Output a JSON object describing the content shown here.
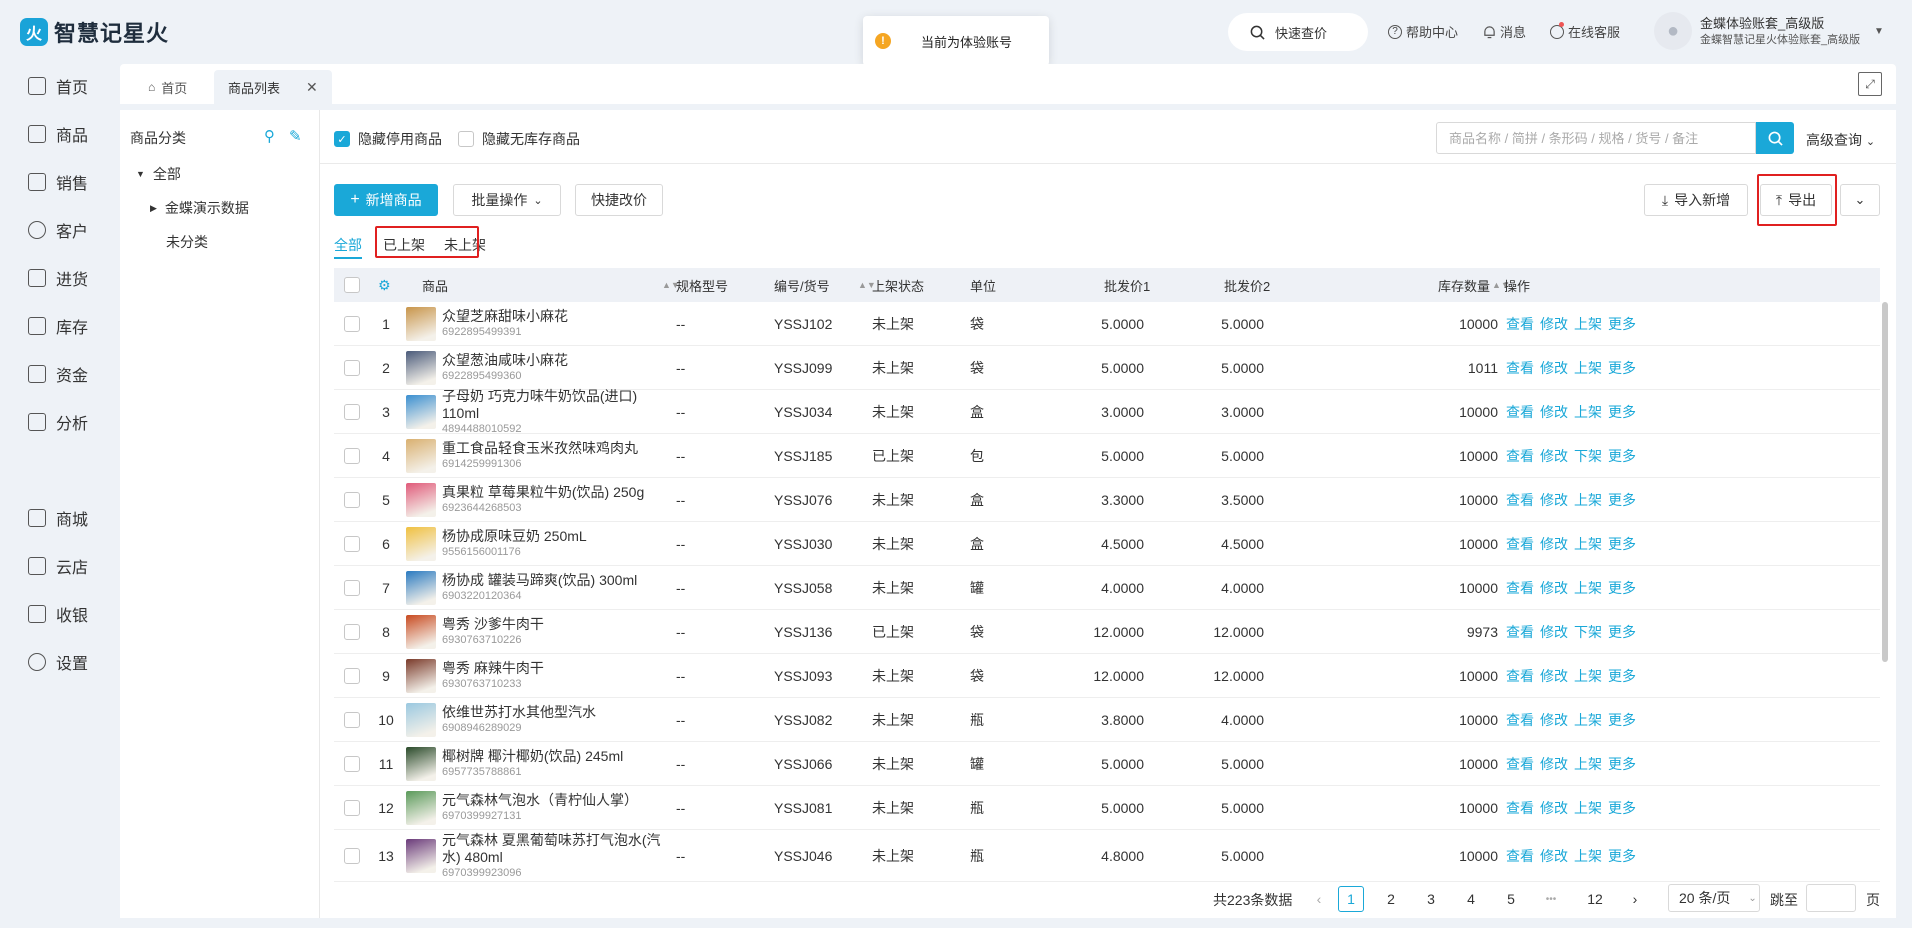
{
  "app": {
    "logo_char": "火",
    "title": "智慧记星火"
  },
  "toast": {
    "icon": "!",
    "text": "当前为体验账号"
  },
  "header": {
    "quick_price": "快速查价",
    "help": "帮助中心",
    "messages": "消息",
    "service": "在线客服",
    "user_name": "金蝶体验账套_高级版",
    "user_sub": "金蝶智慧记星火体验账套_高级版"
  },
  "sidebar": {
    "items": [
      {
        "label": "首页",
        "icon": "home-icon"
      },
      {
        "label": "商品",
        "icon": "product-icon"
      },
      {
        "label": "销售",
        "icon": "sales-icon"
      },
      {
        "label": "客户",
        "icon": "customer-icon"
      },
      {
        "label": "进货",
        "icon": "purchase-icon"
      },
      {
        "label": "库存",
        "icon": "inventory-icon"
      },
      {
        "label": "资金",
        "icon": "fund-icon"
      },
      {
        "label": "分析",
        "icon": "analysis-icon"
      },
      {
        "label": "商城",
        "icon": "mall-icon"
      },
      {
        "label": "云店",
        "icon": "cloud-store-icon"
      },
      {
        "label": "收银",
        "icon": "cashier-icon"
      },
      {
        "label": "设置",
        "icon": "settings-icon"
      }
    ]
  },
  "tabs": [
    {
      "label": "首页"
    },
    {
      "label": "商品列表"
    }
  ],
  "category": {
    "title": "商品分类",
    "root": "全部",
    "child": "金蝶演示数据",
    "uncategorized": "未分类"
  },
  "filters": {
    "hide_disabled": "隐藏停用商品",
    "hide_no_stock": "隐藏无库存商品",
    "search_placeholder": "商品名称 / 简拼 / 条形码 / 规格 / 货号 / 备注",
    "advanced": "高级查询"
  },
  "toolbar": {
    "add": "新增商品",
    "batch": "批量操作",
    "quick_price_edit": "快捷改价",
    "import": "导入新增",
    "export": "导出"
  },
  "status_tabs": [
    "全部",
    "已上架",
    "未上架"
  ],
  "table": {
    "headers": {
      "product": "商品",
      "spec": "规格型号",
      "code": "编号/货号",
      "status": "上架状态",
      "unit": "单位",
      "price1": "批发价1",
      "price2": "批发价2",
      "stock": "库存数量",
      "ops": "操作"
    },
    "ops_view": "查看",
    "ops_edit": "修改",
    "ops_more": "更多",
    "rows": [
      {
        "no": "1",
        "name": "众望芝麻甜味小麻花",
        "barcode": "6922895499391",
        "spec": "--",
        "code": "YSSJ102",
        "status": "未上架",
        "unit": "袋",
        "p1": "5.0000",
        "p2": "5.0000",
        "stock": "10000",
        "toggle": "上架",
        "color": "#c8954a"
      },
      {
        "no": "2",
        "name": "众望葱油咸味小麻花",
        "barcode": "6922895499360",
        "spec": "--",
        "code": "YSSJ099",
        "status": "未上架",
        "unit": "袋",
        "p1": "5.0000",
        "p2": "5.0000",
        "stock": "1011",
        "toggle": "上架",
        "color": "#4a5a7a"
      },
      {
        "no": "3",
        "name": "子母奶 巧克力味牛奶饮品(进口) 110ml",
        "barcode": "4894488010592",
        "spec": "--",
        "code": "YSSJ034",
        "status": "未上架",
        "unit": "盒",
        "p1": "3.0000",
        "p2": "3.0000",
        "stock": "10000",
        "toggle": "上架",
        "color": "#3a8fd0"
      },
      {
        "no": "4",
        "name": "重工食品轻食玉米孜然味鸡肉丸",
        "barcode": "6914259991306",
        "spec": "--",
        "code": "YSSJ185",
        "status": "已上架",
        "unit": "包",
        "p1": "5.0000",
        "p2": "5.0000",
        "stock": "10000",
        "toggle": "下架",
        "color": "#d9b070"
      },
      {
        "no": "5",
        "name": "真果粒 草莓果粒牛奶(饮品) 250g",
        "barcode": "6923644268503",
        "spec": "--",
        "code": "YSSJ076",
        "status": "未上架",
        "unit": "盒",
        "p1": "3.3000",
        "p2": "3.5000",
        "stock": "10000",
        "toggle": "上架",
        "color": "#e05a7a"
      },
      {
        "no": "6",
        "name": "杨协成原味豆奶 250mL",
        "barcode": "9556156001176",
        "spec": "--",
        "code": "YSSJ030",
        "status": "未上架",
        "unit": "盒",
        "p1": "4.5000",
        "p2": "4.5000",
        "stock": "10000",
        "toggle": "上架",
        "color": "#f0c040"
      },
      {
        "no": "7",
        "name": "杨协成 罐装马蹄爽(饮品) 300ml",
        "barcode": "6903220120364",
        "spec": "--",
        "code": "YSSJ058",
        "status": "未上架",
        "unit": "罐",
        "p1": "4.0000",
        "p2": "4.0000",
        "stock": "10000",
        "toggle": "上架",
        "color": "#2a7ac0"
      },
      {
        "no": "8",
        "name": "粤秀 沙爹牛肉干",
        "barcode": "6930763710226",
        "spec": "--",
        "code": "YSSJ136",
        "status": "已上架",
        "unit": "袋",
        "p1": "12.0000",
        "p2": "12.0000",
        "stock": "9973",
        "toggle": "下架",
        "color": "#c84a20"
      },
      {
        "no": "9",
        "name": "粤秀 麻辣牛肉干",
        "barcode": "6930763710233",
        "spec": "--",
        "code": "YSSJ093",
        "status": "未上架",
        "unit": "袋",
        "p1": "12.0000",
        "p2": "12.0000",
        "stock": "10000",
        "toggle": "上架",
        "color": "#7a3a2a"
      },
      {
        "no": "10",
        "name": "依维世苏打水其他型汽水",
        "barcode": "6908946289029",
        "spec": "--",
        "code": "YSSJ082",
        "status": "未上架",
        "unit": "瓶",
        "p1": "3.8000",
        "p2": "4.0000",
        "stock": "10000",
        "toggle": "上架",
        "color": "#9ac8e0"
      },
      {
        "no": "11",
        "name": "椰树牌 椰汁椰奶(饮品) 245ml",
        "barcode": "6957735788861",
        "spec": "--",
        "code": "YSSJ066",
        "status": "未上架",
        "unit": "罐",
        "p1": "5.0000",
        "p2": "5.0000",
        "stock": "10000",
        "toggle": "上架",
        "color": "#2a4a2a"
      },
      {
        "no": "12",
        "name": "元气森林气泡水（青柠仙人掌）",
        "barcode": "6970399927131",
        "spec": "--",
        "code": "YSSJ081",
        "status": "未上架",
        "unit": "瓶",
        "p1": "5.0000",
        "p2": "5.0000",
        "stock": "10000",
        "toggle": "上架",
        "color": "#5a9a5a"
      },
      {
        "no": "13",
        "name": "元气森林 夏黑葡萄味苏打气泡水(汽水) 480ml",
        "barcode": "6970399923096",
        "spec": "--",
        "code": "YSSJ046",
        "status": "未上架",
        "unit": "瓶",
        "p1": "4.8000",
        "p2": "5.0000",
        "stock": "10000",
        "toggle": "上架",
        "color": "#6a3a7a"
      }
    ]
  },
  "pagination": {
    "total": "共223条数据",
    "prev": "‹",
    "next": "›",
    "pages": [
      "1",
      "2",
      "3",
      "4",
      "5",
      "•••",
      "12"
    ],
    "page_size": "20 条/页",
    "jump_label": "跳至",
    "page_suffix": "页"
  }
}
